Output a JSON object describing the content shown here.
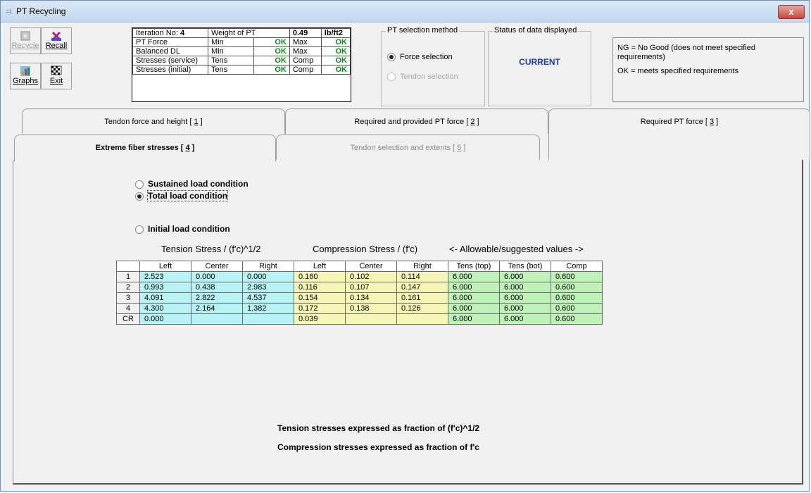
{
  "window": {
    "title": "PT Recycling",
    "close_label": "x"
  },
  "toolbar": {
    "recycle_label": "Recycle",
    "recall_label": "Recall",
    "graphs_label": "Graphs",
    "exit_label": "Exit"
  },
  "status_grid": {
    "iteration_label": "Iteration No:",
    "iteration_value": "4",
    "weight_label": "Weight of PT",
    "weight_value": "0.49",
    "weight_unit": "lb/ft2",
    "rows": [
      {
        "label": "PT Force",
        "min_label": "Min",
        "min_val": "OK",
        "max_label": "Max",
        "max_val": "OK"
      },
      {
        "label": "Balanced DL",
        "min_label": "Min",
        "min_val": "OK",
        "max_label": "Max",
        "max_val": "OK"
      },
      {
        "label": "Stresses (service)",
        "min_label": "Tens",
        "min_val": "OK",
        "max_label": "Comp",
        "max_val": "OK"
      },
      {
        "label": "Stresses (initial)",
        "min_label": "Tens",
        "min_val": "OK",
        "max_label": "Comp",
        "max_val": "OK"
      }
    ]
  },
  "pt_selection": {
    "title": "PT selection method",
    "force_label": "Force selection",
    "tendon_label": "Tendon selection"
  },
  "status_display": {
    "title": "Status of data displayed",
    "value": "CURRENT",
    "value_color": "#1a3fa8"
  },
  "legend_box": {
    "ng_text": "NG = No Good (does not meet specified requirements)",
    "ok_text": "OK = meets specified requirements"
  },
  "tabs": {
    "tab1_text": "Tendon force and height [ ",
    "tab1_key": "1",
    "tab2_text": "Required and provided PT force [ ",
    "tab2_key": "2",
    "tab3_text": "Required PT force [ ",
    "tab3_key": "3",
    "tab4_text": "Extreme fiber stresses [ ",
    "tab4_key": "4",
    "tab5_text": "Tendon selection and extents [ ",
    "tab5_key": "5",
    "close_bracket": " ]"
  },
  "load_conditions": {
    "sustained": "Sustained load condition",
    "total": "Total load condition",
    "initial": "Initial load condition"
  },
  "captions": {
    "tension": "Tension Stress / (f'c)^1/2",
    "compression": "Compression Stress / (f'c)",
    "allowable": "<- Allowable/suggested values ->"
  },
  "stress_table": {
    "headers": [
      "",
      "Left",
      "Center",
      "Right",
      "Left",
      "Center",
      "Right",
      "Tens (top)",
      "Tens (bot)",
      "Comp"
    ],
    "rows": [
      {
        "label": "1",
        "t": [
          "2.523",
          "0.000",
          "0.000"
        ],
        "c": [
          "0.160",
          "0.102",
          "0.114"
        ],
        "a": [
          "6.000",
          "6.000",
          "0.600"
        ]
      },
      {
        "label": "2",
        "t": [
          "0.993",
          "0.438",
          "2.983"
        ],
        "c": [
          "0.116",
          "0.107",
          "0.147"
        ],
        "a": [
          "6.000",
          "6.000",
          "0.600"
        ]
      },
      {
        "label": "3",
        "t": [
          "4.091",
          "2.822",
          "4.537"
        ],
        "c": [
          "0.154",
          "0.134",
          "0.161"
        ],
        "a": [
          "6.000",
          "6.000",
          "0.600"
        ]
      },
      {
        "label": "4",
        "t": [
          "4.300",
          "2.164",
          "1.382"
        ],
        "c": [
          "0.172",
          "0.138",
          "0.126"
        ],
        "a": [
          "6.000",
          "6.000",
          "0.600"
        ]
      },
      {
        "label": "CR",
        "t": [
          "0.000",
          "",
          ""
        ],
        "c": [
          "0.039",
          "",
          ""
        ],
        "a": [
          "6.000",
          "6.000",
          "0.600"
        ]
      }
    ]
  },
  "notes": {
    "tension_note": "Tension stresses expressed as fraction of (f'c)^1/2",
    "compression_note": "Compression stresses expressed as fraction of f'c"
  }
}
